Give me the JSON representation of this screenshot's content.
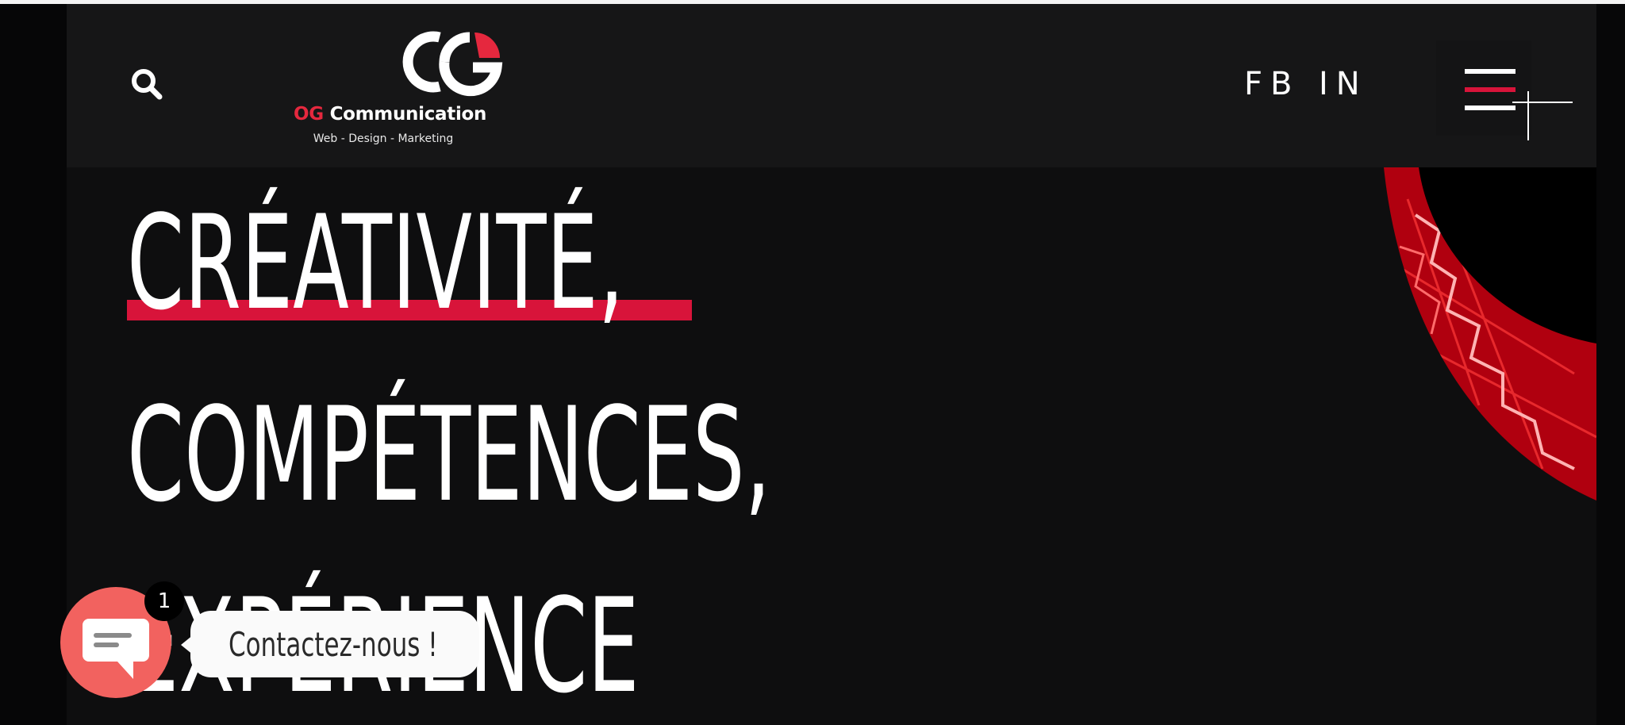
{
  "header": {
    "logo_prefix": "OG",
    "logo_name": "Communication",
    "logo_tagline": "Web - Design - Marketing",
    "social": [
      {
        "label": "FB"
      },
      {
        "label": "IN"
      }
    ]
  },
  "hero": {
    "lines": [
      "CRÉATIVITÉ,",
      "COMPÉTENCES,",
      "EXPÉRIENCE"
    ]
  },
  "chat_widget": {
    "badge_count": "1",
    "label": "Contactez-nous !"
  },
  "colors": {
    "accent_red": "#d8143a",
    "chat_button": "#f2625f",
    "background": "#0e0e0f"
  },
  "icons": [
    "search-icon",
    "menu-icon",
    "chat-icon"
  ]
}
